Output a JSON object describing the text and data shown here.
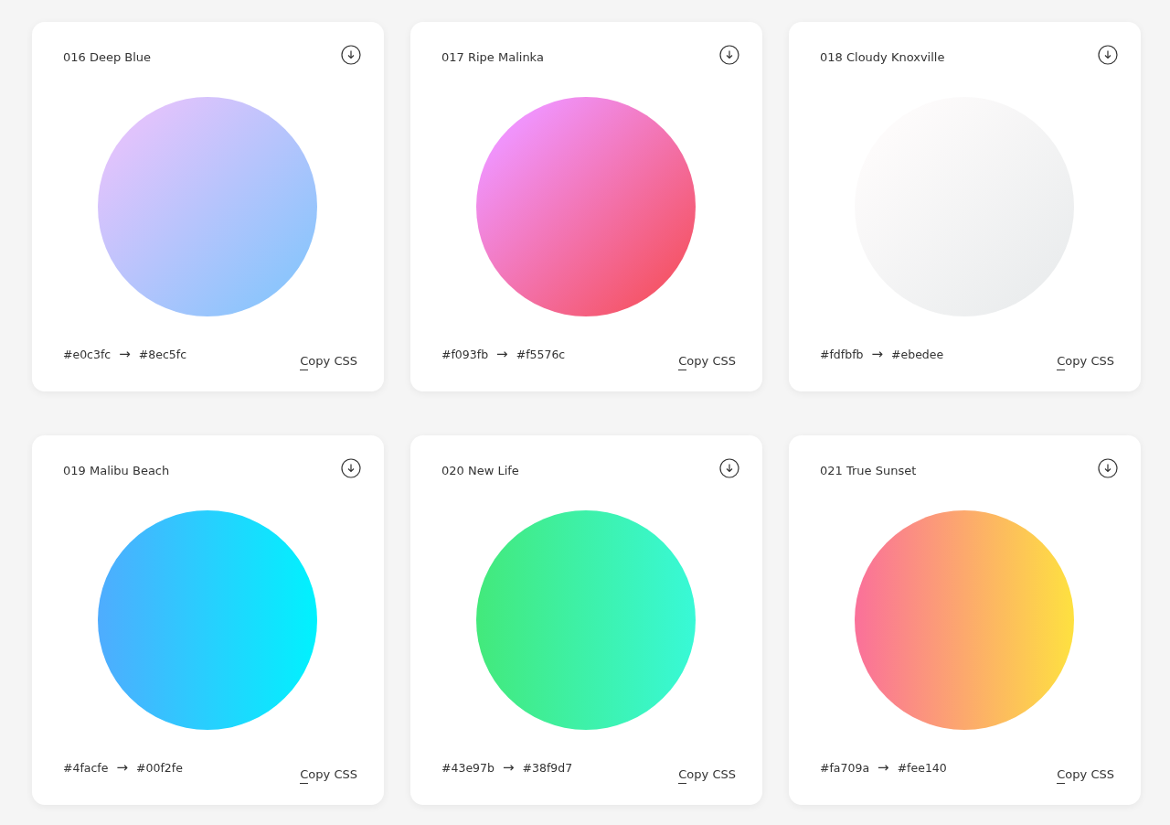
{
  "cards": [
    {
      "title": "016 Deep Blue",
      "circle": {
        "kind": "diagonal",
        "stops": [
          {
            "color": "#e0c3fc"
          },
          {
            "color": "#8ec5fc"
          }
        ]
      },
      "from": "#e0c3fc",
      "arrow": "→",
      "to": "#8ec5fc",
      "action": "Copy CSS"
    },
    {
      "title": "017 Ripe Malinka",
      "circle": {
        "kind": "diagonal",
        "stops": [
          {
            "color": "#f093fb"
          },
          {
            "color": "#f5576c"
          }
        ]
      },
      "from": "#f093fb",
      "arrow": "→",
      "to": "#f5576c",
      "action": "Copy CSS"
    },
    {
      "title": "018 Cloudy Knoxville",
      "circle": {
        "kind": "diagonal",
        "stops": [
          {
            "color": "#fdfbfb"
          },
          {
            "color": "#ebedee"
          }
        ]
      },
      "from": "#fdfbfb",
      "arrow": "→",
      "to": "#ebedee",
      "action": "Copy CSS"
    },
    {
      "title": "019 Malibu Beach",
      "circle": {
        "kind": "horizontal",
        "stops": [
          {
            "color": "#4facfe"
          },
          {
            "color": "#00f2fe"
          }
        ]
      },
      "from": "#4facfe",
      "arrow": "→",
      "to": "#00f2fe",
      "action": "Copy CSS"
    },
    {
      "title": "020 New Life",
      "circle": {
        "kind": "horizontal",
        "stops": [
          {
            "color": "#43e97b"
          },
          {
            "color": "#38f9d7"
          }
        ]
      },
      "from": "#43e97b",
      "arrow": "→",
      "to": "#38f9d7",
      "action": "Copy CSS"
    },
    {
      "title": "021 True Sunset",
      "circle": {
        "kind": "horizontal",
        "stops": [
          {
            "color": "#fa709a"
          },
          {
            "color": "#fee140"
          }
        ]
      },
      "from": "#fa709a",
      "arrow": "→",
      "to": "#fee140",
      "action": "Copy CSS"
    }
  ]
}
